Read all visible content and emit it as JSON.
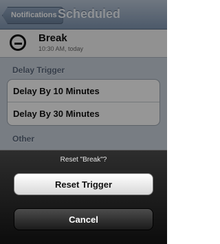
{
  "navbar": {
    "back_label": "Notifications",
    "title": "Scheduled"
  },
  "task": {
    "name": "Break",
    "time": "10:30 AM, today"
  },
  "sections": {
    "delay_header": "Delay Trigger",
    "delay_items": [
      {
        "label": "Delay By 10 Minutes"
      },
      {
        "label": "Delay By 30 Minutes"
      }
    ],
    "other_header": "Other"
  },
  "action_sheet": {
    "title": "Reset \"Break\"?",
    "confirm_label": "Reset Trigger",
    "cancel_label": "Cancel"
  }
}
